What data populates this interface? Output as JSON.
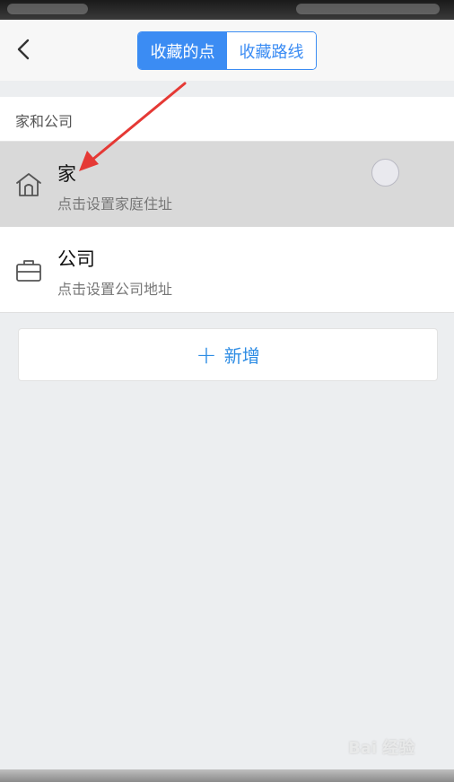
{
  "navbar": {
    "tabs": [
      {
        "label": "收藏的点",
        "active": true
      },
      {
        "label": "收藏路线",
        "active": false
      }
    ]
  },
  "section": {
    "header": "家和公司"
  },
  "items": [
    {
      "title": "家",
      "subtitle": "点击设置家庭住址",
      "icon": "home-icon"
    },
    {
      "title": "公司",
      "subtitle": "点击设置公司地址",
      "icon": "briefcase-icon"
    }
  ],
  "add_button": {
    "icon": "+",
    "label": "新增"
  },
  "watermark": "Bai 经验",
  "colors": {
    "accent": "#3b8cf3",
    "add_text": "#2f8de4",
    "annotation_arrow": "#e53935",
    "highlight_row": "#d9d9d9",
    "background": "#eceef0"
  }
}
